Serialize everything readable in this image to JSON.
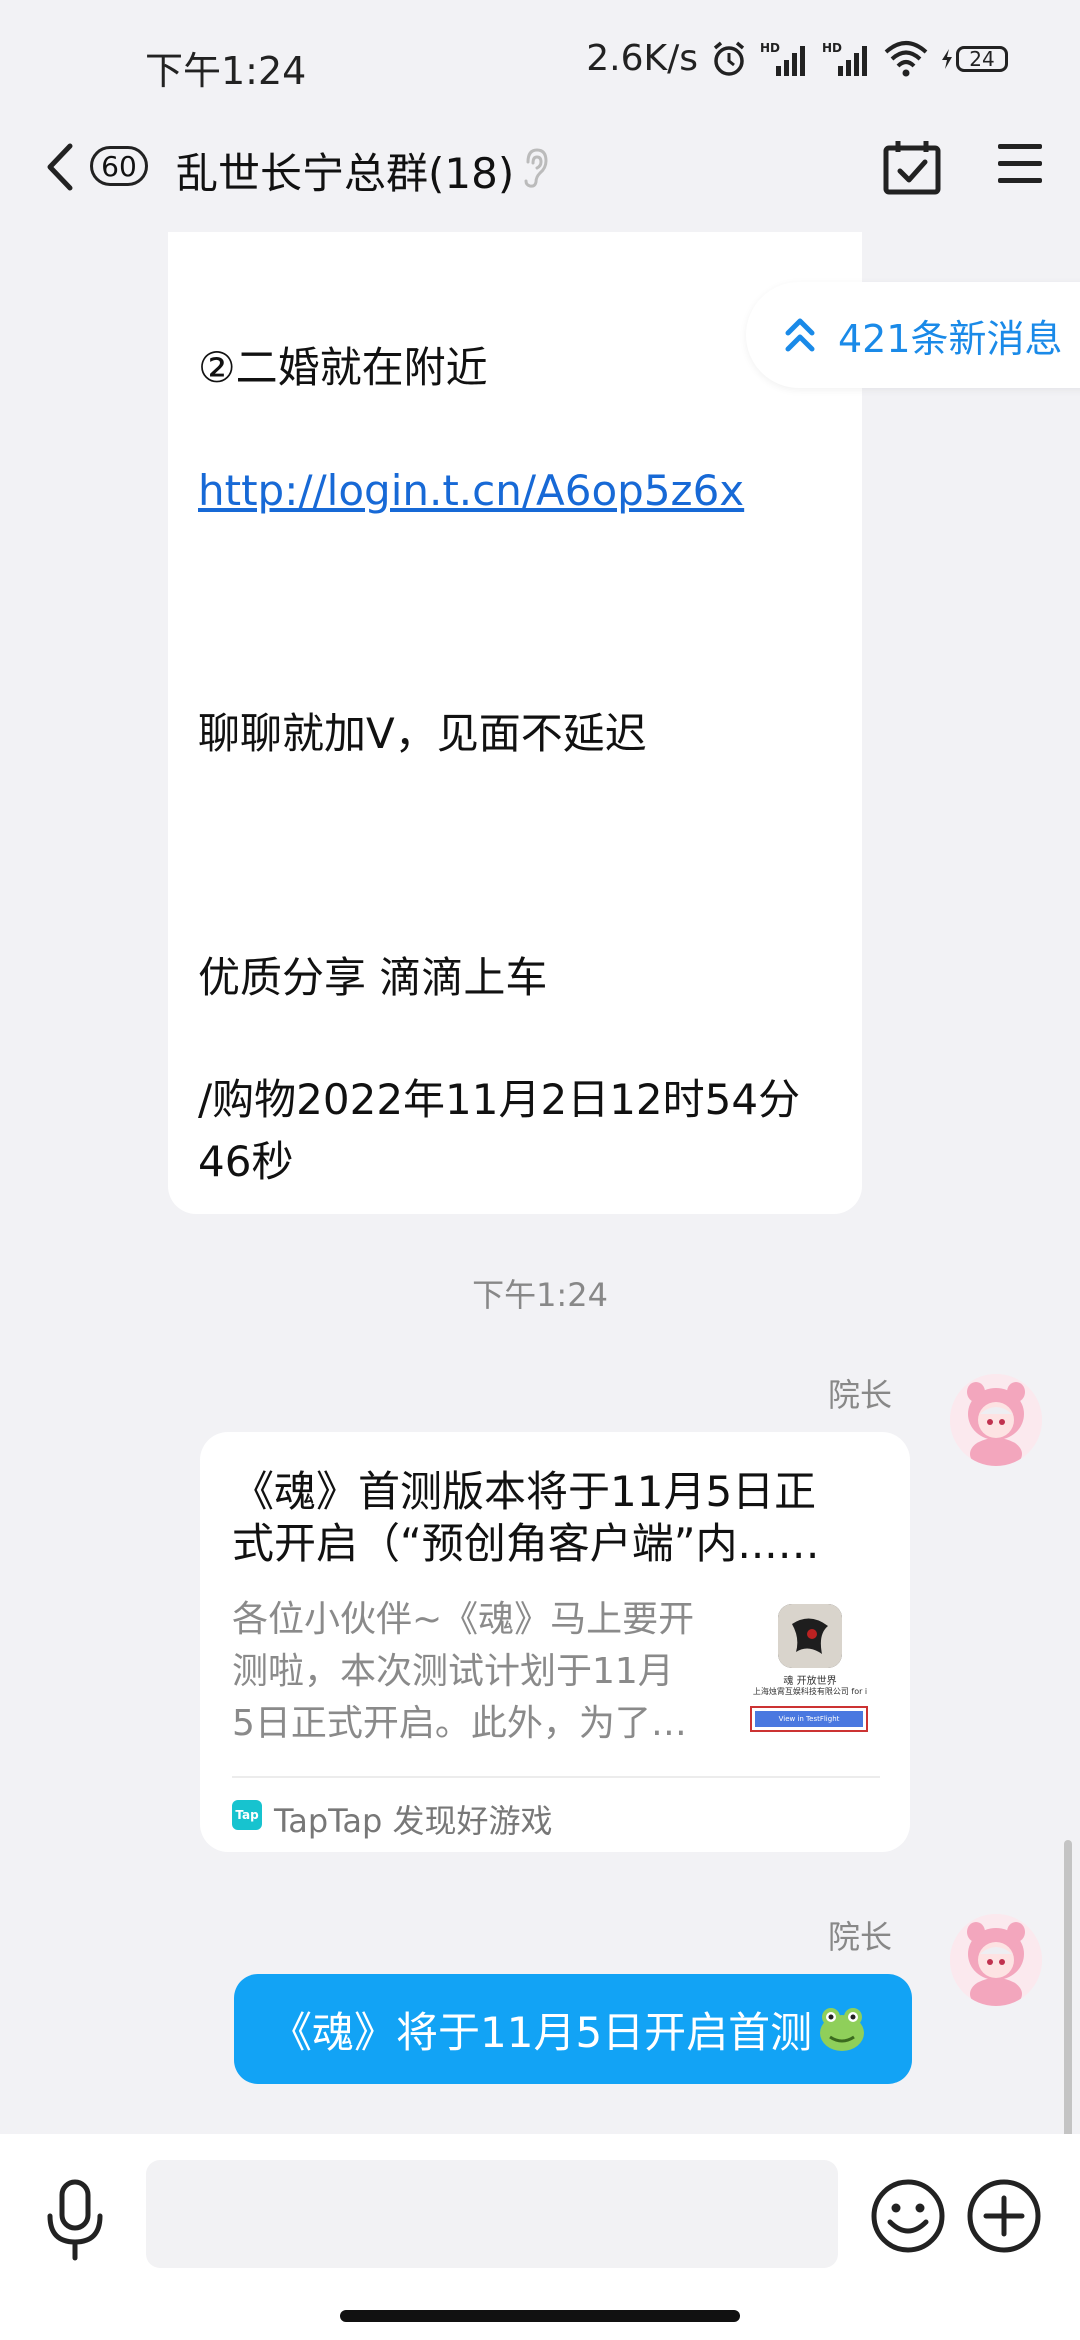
{
  "status": {
    "time": "下午1:24",
    "net_speed": "2.6K/s",
    "battery": "24"
  },
  "header": {
    "unread_count": "60",
    "title": "乱世长宁总群(18)"
  },
  "new_messages": "421条新消息",
  "first_message": {
    "line1": "②二婚就在附近",
    "link": "http://login.t.cn/A6op5z6x",
    "line2": "聊聊就加V，见面不延迟",
    "line3": "优质分享  滴滴上车",
    "line4a": "/购物2022年11月2日12时54分",
    "line4b": "46秒"
  },
  "timestamp": "下午1:24",
  "share_card": {
    "sender": "院长",
    "title_line1": "《魂》首测版本将于11月5日正",
    "title_line2": "式开启（“预创角客户端”内...…",
    "desc_line1": "各位小伙伴~《魂》马上要开",
    "desc_line2": "测啦，本次测试计划于11月",
    "desc_line3": "5日正式开启。此外，为了…",
    "thumb_caption": "魂 开放世界",
    "thumb_company": "上海烛霄互娱科技有限公司 for i",
    "thumb_button": "View in TestFlight",
    "source_logo": "Tap",
    "source": "TapTap 发现好游戏"
  },
  "text_message": {
    "sender": "院长",
    "text": "《魂》将于11月5日开启首测"
  }
}
